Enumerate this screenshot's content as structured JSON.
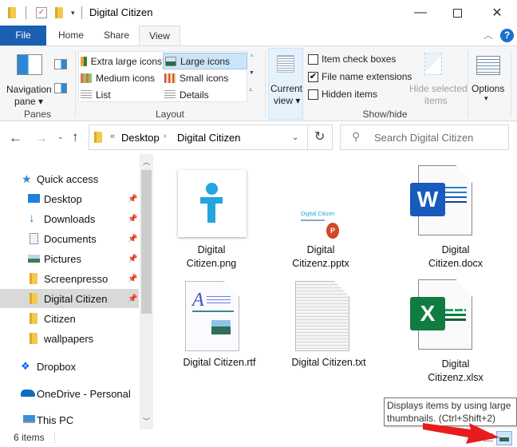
{
  "window": {
    "title": "Digital Citizen",
    "minimize_icon": "minimize-icon",
    "maximize_icon": "maximize-icon",
    "close_icon": "close-icon"
  },
  "tabs": [
    {
      "label": "File"
    },
    {
      "label": "Home"
    },
    {
      "label": "Share"
    },
    {
      "label": "View",
      "active": true
    }
  ],
  "ribbon": {
    "panes": {
      "navigation_pane": "Navigation",
      "navigation_pane_2": "pane",
      "group_label": "Panes"
    },
    "layout": {
      "items": [
        {
          "label": "Extra large icons"
        },
        {
          "label": "Large icons",
          "selected": true
        },
        {
          "label": "Medium icons"
        },
        {
          "label": "Small icons"
        },
        {
          "label": "List"
        },
        {
          "label": "Details"
        }
      ],
      "group_label": "Layout"
    },
    "current_view": {
      "line1": "Current",
      "line2": "view"
    },
    "show_hide": {
      "item_check_boxes": {
        "label": "Item check boxes",
        "checked": false
      },
      "file_name_extensions": {
        "label": "File name extensions",
        "checked": true
      },
      "hidden_items": {
        "label": "Hidden items",
        "checked": false
      },
      "hide_selected": {
        "line1": "Hide selected",
        "line2": "items"
      },
      "group_label": "Show/hide"
    },
    "options": {
      "label": "Options"
    }
  },
  "address": {
    "back_icon": "arrow-left-icon",
    "forward_icon": "arrow-right-icon",
    "breadcrumb_overflow": "«",
    "crumbs": [
      "Desktop",
      "Digital Citizen"
    ],
    "search_placeholder": "Search Digital Citizen"
  },
  "sidebar": {
    "items": [
      {
        "label": "Quick access",
        "icon": "star-icon"
      },
      {
        "label": "Desktop",
        "icon": "desktop-icon",
        "pinned": true
      },
      {
        "label": "Downloads",
        "icon": "download-icon",
        "pinned": true
      },
      {
        "label": "Documents",
        "icon": "documents-icon",
        "pinned": true
      },
      {
        "label": "Pictures",
        "icon": "pictures-icon",
        "pinned": true
      },
      {
        "label": "Screenpresso",
        "icon": "folder-icon",
        "pinned": true
      },
      {
        "label": "Digital Citizen",
        "icon": "folder-icon",
        "pinned": true,
        "selected": true
      },
      {
        "label": "Citizen",
        "icon": "folder-icon"
      },
      {
        "label": "wallpapers",
        "icon": "folder-icon"
      },
      {
        "label": "Dropbox",
        "icon": "dropbox-icon"
      },
      {
        "label": "OneDrive - Personal",
        "icon": "onedrive-icon"
      },
      {
        "label": "This PC",
        "icon": "this-pc-icon"
      }
    ]
  },
  "files": [
    {
      "line1": "Digital",
      "line2": "Citizen.png",
      "type": "png"
    },
    {
      "line1": "Digital",
      "line2": "Citizenz.pptx",
      "type": "pptx"
    },
    {
      "line1": "Digital",
      "line2": "Citizen.docx",
      "type": "docx"
    },
    {
      "line1": "Digital Citizen.rtf",
      "line2": "",
      "type": "rtf"
    },
    {
      "line1": "Digital Citizen.txt",
      "line2": "",
      "type": "txt"
    },
    {
      "line1": "Digital",
      "line2": "Citizenz.xlsx",
      "type": "xlsx"
    }
  ],
  "pptx_thumb": {
    "title": "Digital Citizen"
  },
  "status": {
    "count": "6 items"
  },
  "tooltip": {
    "line1": "Displays items by using large",
    "line2": "thumbnails.  (Ctrl+Shift+2)"
  },
  "colors": {
    "accent": "#1a5fb4",
    "selection": "#cce4f7",
    "folder": "#f3c94e"
  }
}
